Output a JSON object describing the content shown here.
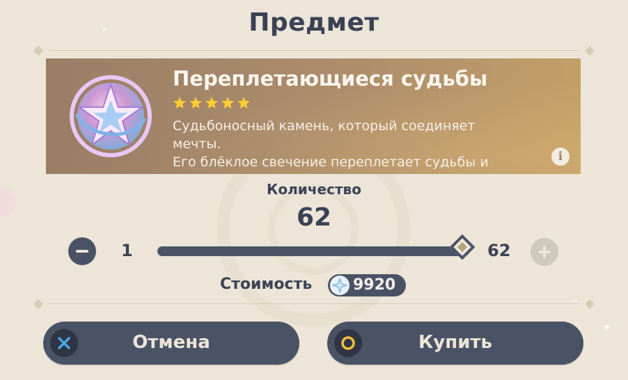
{
  "dialog": {
    "title": "Предмет"
  },
  "item": {
    "name": "Переплетающиеся судьбы",
    "rarity_stars": 5,
    "description_lines": [
      "Судьбоносный камень, который соединяет",
      "мечты.",
      "Его блёклое свечение переплетает судьбы и"
    ],
    "info_icon": "info-icon",
    "icon": "intertwined-fate-icon"
  },
  "quantity": {
    "label": "Количество",
    "value": "62",
    "min_label": "1",
    "max_label": "62",
    "slider_fraction": 1.0
  },
  "cost": {
    "label": "Стоимость",
    "currency_icon": "primogem-icon",
    "value": "9920"
  },
  "buttons": {
    "cancel_label": "Отмена",
    "buy_label": "Купить"
  },
  "colors": {
    "background": "#ece5d8",
    "primary_dark": "#4a5366",
    "text_dark": "#3b4255",
    "star": "#ffcc32",
    "cancel_icon": "#4aa8e8",
    "buy_icon": "#f2c33a"
  }
}
